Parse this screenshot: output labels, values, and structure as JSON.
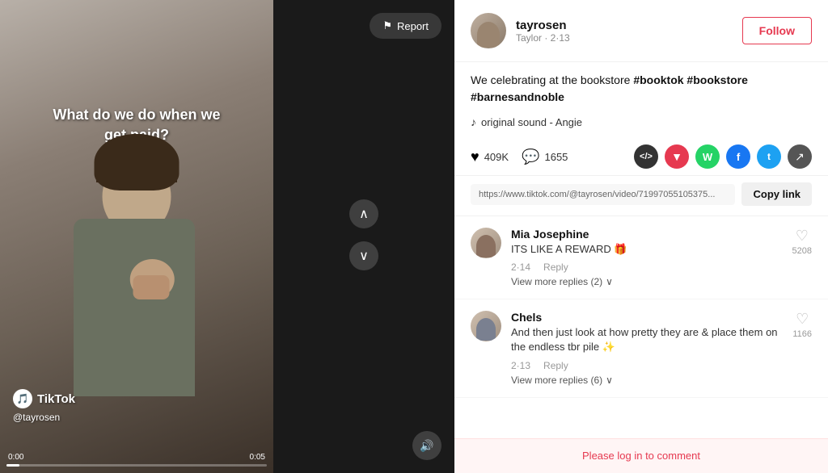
{
  "video": {
    "overlay_text": "What do we do when we get paid?",
    "tiktok_label": "TikTok",
    "username": "@tayrosen",
    "time_current": "0:00",
    "time_total": "0:05",
    "progress_width": "5%"
  },
  "middle": {
    "report_label": "Report"
  },
  "post": {
    "author_name": "tayrosen",
    "author_sub": "Taylor · 2·13",
    "follow_label": "Follow",
    "caption": "We celebrating at the bookstore ",
    "hashtags": "#booktok #bookstore #barnesandnoble",
    "sound": "original sound - Angie",
    "likes": "409K",
    "comments": "1655",
    "link_url": "https://www.tiktok.com/@tayrosen/video/71997055105375...",
    "copy_link_label": "Copy link"
  },
  "comments": [
    {
      "name": "Mia Josephine",
      "text": "ITS LIKE A REWARD 🎁",
      "date": "2·14",
      "likes": "5208",
      "replies_count": "2"
    },
    {
      "name": "Chels",
      "text": "And then just look at how pretty they are & place them on the endless tbr pile ✨",
      "date": "2·13",
      "likes": "1166",
      "replies_count": "6"
    }
  ],
  "login": {
    "text": "Please log in to comment"
  },
  "icons": {
    "flag": "⚑",
    "heart": "♥",
    "comment": "💬",
    "code": "</>",
    "tiktok_share": "▼",
    "whatsapp": "W",
    "facebook": "f",
    "twitter": "t",
    "share_arrow": "↗",
    "note": "♪",
    "up_arrow": "∧",
    "down_arrow": "∨",
    "volume": "🔊"
  }
}
